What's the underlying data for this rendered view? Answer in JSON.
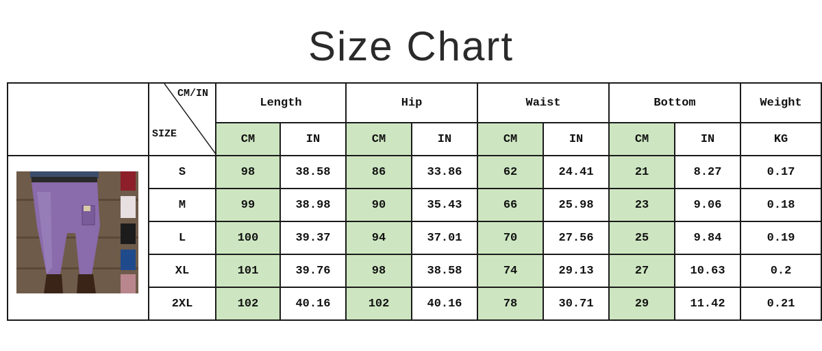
{
  "title": "Size Chart",
  "corner": {
    "top_right": "CM/IN",
    "bottom_left": "SIZE"
  },
  "groups": [
    "Length",
    "Hip",
    "Waist",
    "Bottom",
    "Weight"
  ],
  "units": [
    "CM",
    "IN",
    "CM",
    "IN",
    "CM",
    "IN",
    "CM",
    "IN",
    "KG"
  ],
  "rows": [
    {
      "size": "S",
      "cells": [
        "98",
        "38.58",
        "86",
        "33.86",
        "62",
        "24.41",
        "21",
        "8.27",
        "0.17"
      ]
    },
    {
      "size": "M",
      "cells": [
        "99",
        "38.98",
        "90",
        "35.43",
        "66",
        "25.98",
        "23",
        "9.06",
        "0.18"
      ]
    },
    {
      "size": "L",
      "cells": [
        "100",
        "39.37",
        "94",
        "37.01",
        "70",
        "27.56",
        "25",
        "9.84",
        "0.19"
      ]
    },
    {
      "size": "XL",
      "cells": [
        "101",
        "39.76",
        "98",
        "38.58",
        "74",
        "29.13",
        "27",
        "10.63",
        "0.2"
      ]
    },
    {
      "size": "2XL",
      "cells": [
        "102",
        "40.16",
        "102",
        "40.16",
        "78",
        "30.71",
        "29",
        "11.42",
        "0.21"
      ]
    }
  ],
  "colors": {
    "cm_highlight": "#cde6c1",
    "legging_purple": "#8a6bab",
    "border": "#1a1a1a"
  },
  "product_image": "purple riding leggings photo with color swatches"
}
